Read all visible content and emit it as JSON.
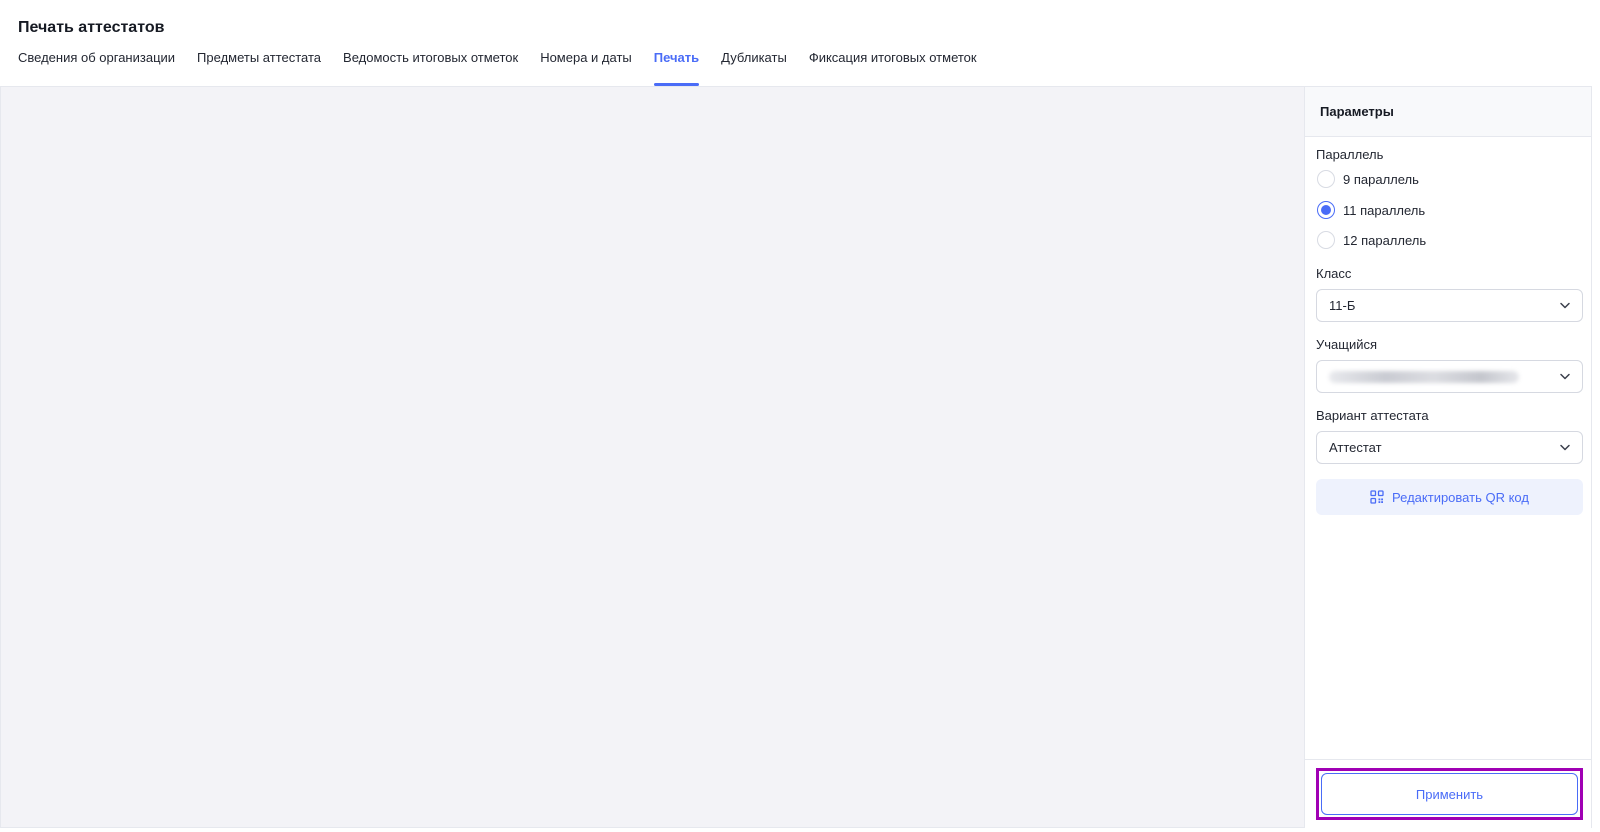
{
  "page": {
    "title": "Печать аттестатов",
    "tabs": [
      {
        "label": "Сведения об организации",
        "active": false
      },
      {
        "label": "Предметы аттестата",
        "active": false
      },
      {
        "label": "Ведомость итоговых отметок",
        "active": false
      },
      {
        "label": "Номера и даты",
        "active": false
      },
      {
        "label": "Печать",
        "active": true
      },
      {
        "label": "Дубликаты",
        "active": false
      },
      {
        "label": "Фиксация итоговых отметок",
        "active": false
      }
    ]
  },
  "params": {
    "title": "Параметры",
    "parallel": {
      "label": "Параллель",
      "options": [
        {
          "label": "9 параллель",
          "checked": false
        },
        {
          "label": "11 параллель",
          "checked": true
        },
        {
          "label": "12 параллель",
          "checked": false
        }
      ]
    },
    "class": {
      "label": "Класс",
      "value": "11-Б"
    },
    "student": {
      "label": "Учащийся",
      "value_obscured": true
    },
    "variant": {
      "label": "Вариант аттестата",
      "value": "Аттестат"
    },
    "qr_button": {
      "label": "Редактировать QR код",
      "icon": "qr-code-icon"
    },
    "apply_button": {
      "label": "Применить"
    }
  },
  "colors": {
    "accent": "#4a6cf7",
    "highlight": "#a000b4",
    "preview_bg": "#f3f3f7"
  }
}
